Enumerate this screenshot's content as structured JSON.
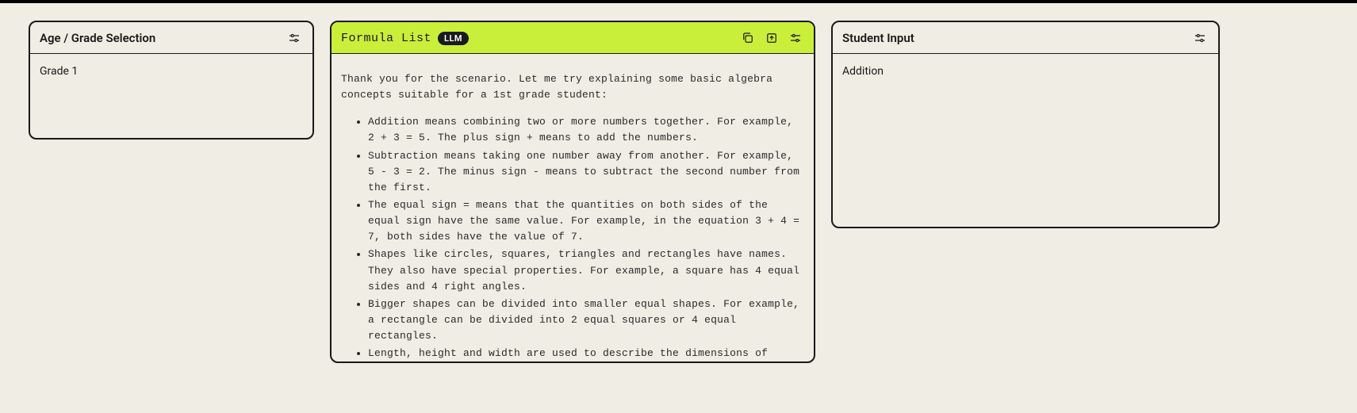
{
  "panels": {
    "age": {
      "title": "Age / Grade Selection",
      "value": "Grade 1"
    },
    "formula": {
      "title": "Formula List",
      "badge": "LLM",
      "intro": "Thank you for the scenario. Let me try explaining some basic algebra concepts suitable for a 1st grade student:",
      "bullets": [
        "Addition means combining two or more numbers together. For example, 2 + 3 = 5. The plus sign + means to add the numbers.",
        "Subtraction means taking one number away from another. For example, 5 - 3 = 2. The minus sign - means to subtract the second number from the first.",
        "The equal sign = means that the quantities on both sides of the equal sign have the same value. For example, in the equation 3 + 4 = 7, both sides have the value of 7.",
        "Shapes like circles, squares, triangles and rectangles have names. They also have special properties. For example, a square has 4 equal sides and 4 right angles.",
        "Bigger shapes can be divided into smaller equal shapes. For example, a rectangle can be divided into 2 equal squares or 4 equal rectangles.",
        "Length, height and width are used to describe the dimensions of shapes. For example, the length of a rectangle is the horizontal distance while the height is the vertical distance"
      ]
    },
    "student": {
      "title": "Student Input",
      "value": "Addition"
    }
  }
}
